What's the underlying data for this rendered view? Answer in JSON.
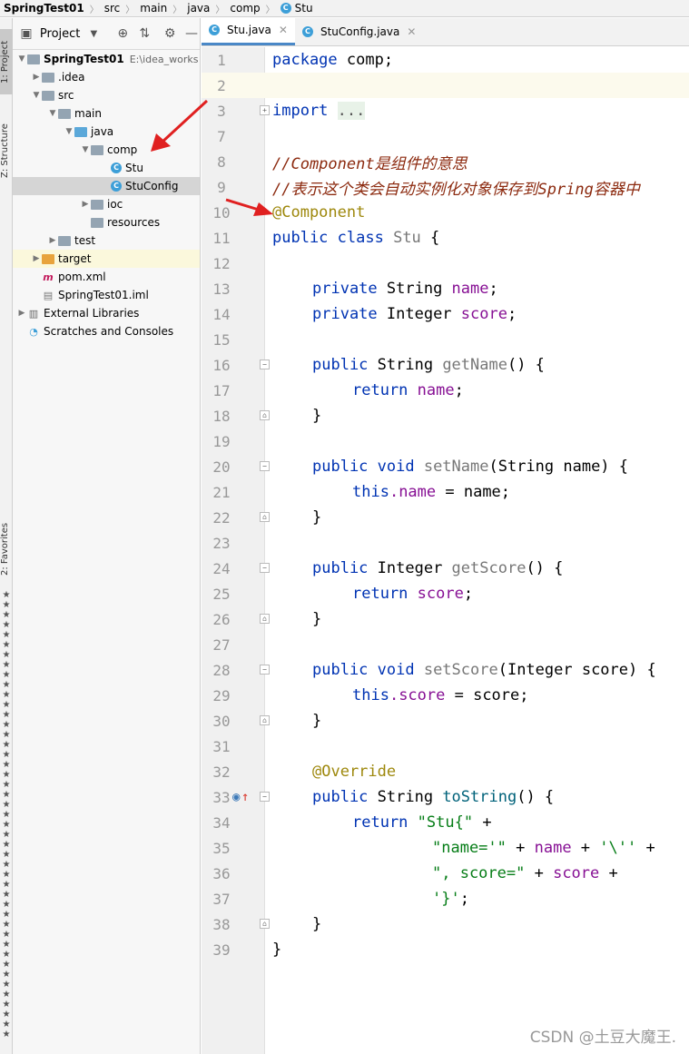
{
  "breadcrumb": [
    "SpringTest01",
    "src",
    "main",
    "java",
    "comp",
    "Stu"
  ],
  "sidebar_tabs": {
    "project": "1: Project",
    "structure": "Z: Structure",
    "favorites": "2: Favorites"
  },
  "project_panel": {
    "title": "Project",
    "tree": [
      {
        "label": "SpringTest01",
        "path": "E:\\idea_works",
        "type": "module",
        "bold": true
      },
      {
        "label": ".idea",
        "type": "folder"
      },
      {
        "label": "src",
        "type": "folder"
      },
      {
        "label": "main",
        "type": "folder"
      },
      {
        "label": "java",
        "type": "folder-blue"
      },
      {
        "label": "comp",
        "type": "package"
      },
      {
        "label": "Stu",
        "type": "class"
      },
      {
        "label": "StuConfig",
        "type": "class"
      },
      {
        "label": "ioc",
        "type": "package"
      },
      {
        "label": "resources",
        "type": "resources"
      },
      {
        "label": "test",
        "type": "folder"
      },
      {
        "label": "target",
        "type": "folder-orange"
      },
      {
        "label": "pom.xml",
        "type": "maven"
      },
      {
        "label": "SpringTest01.iml",
        "type": "iml"
      },
      {
        "label": "External Libraries",
        "type": "libs"
      },
      {
        "label": "Scratches and Consoles",
        "type": "scratch"
      }
    ]
  },
  "tabs": [
    {
      "label": "Stu.java",
      "active": true
    },
    {
      "label": "StuConfig.java",
      "active": false
    }
  ],
  "code_lines": [
    {
      "n": "1"
    },
    {
      "n": "2"
    },
    {
      "n": "3"
    },
    {
      "n": "7"
    },
    {
      "n": "8"
    },
    {
      "n": "9"
    },
    {
      "n": "10"
    },
    {
      "n": "11"
    },
    {
      "n": "12"
    },
    {
      "n": "13"
    },
    {
      "n": "14"
    },
    {
      "n": "15"
    },
    {
      "n": "16"
    },
    {
      "n": "17"
    },
    {
      "n": "18"
    },
    {
      "n": "19"
    },
    {
      "n": "20"
    },
    {
      "n": "21"
    },
    {
      "n": "22"
    },
    {
      "n": "23"
    },
    {
      "n": "24"
    },
    {
      "n": "25"
    },
    {
      "n": "26"
    },
    {
      "n": "27"
    },
    {
      "n": "28"
    },
    {
      "n": "29"
    },
    {
      "n": "30"
    },
    {
      "n": "31"
    },
    {
      "n": "32"
    },
    {
      "n": "33"
    },
    {
      "n": "34"
    },
    {
      "n": "35"
    },
    {
      "n": "36"
    },
    {
      "n": "37"
    },
    {
      "n": "38"
    },
    {
      "n": "39"
    }
  ],
  "code": {
    "l1_kw": "package",
    "l1_rest": " comp;",
    "l3_kw": "import",
    "l3_fold": "...",
    "l8": "//Component是组件的意思",
    "l9": "//表示这个类会自动实例化对象保存到Spring容器中",
    "l10": "@Component",
    "l11_kw": "public class",
    "l11_name": "Stu",
    "l11_rest": " {",
    "l13_kw": "private",
    "l13_type": " String ",
    "l13_fld": "name",
    "l13_end": ";",
    "l14_kw": "private",
    "l14_type": " Integer ",
    "l14_fld": "score",
    "l14_end": ";",
    "l16_kw": "public",
    "l16_type": " String ",
    "l16_m": "getName",
    "l16_end": "() {",
    "l17_kw": "return",
    "l17_fld": " name",
    "l17_end": ";",
    "close": "}",
    "l20_kw": "public void",
    "l20_m": " setName",
    "l20_end": "(String name) {",
    "l21_kw": "this",
    "l21_fld": ".name",
    "l21_end": " = name;",
    "l24_kw": "public",
    "l24_type": " Integer ",
    "l24_m": "getScore",
    "l24_end": "() {",
    "l25_kw": "return",
    "l25_fld": " score",
    "l25_end": ";",
    "l28_kw": "public void",
    "l28_m": " setScore",
    "l28_end": "(Integer score) {",
    "l29_kw": "this",
    "l29_fld": ".score",
    "l29_end": " = score;",
    "l32": "@Override",
    "l33_kw": "public",
    "l33_type": " String ",
    "l33_m": "toString",
    "l33_end": "() {",
    "l34_kw": "return",
    "l34_str": " \"Stu{\"",
    "l34_end": " +",
    "l35_str": "\"name='\"",
    "l35_mid": " + ",
    "l35_fld": "name",
    "l35_mid2": " + ",
    "l35_str2": "'\\''",
    "l35_end": " +",
    "l36_str": "\", score=\"",
    "l36_mid": " + ",
    "l36_fld": "score",
    "l36_end": " +",
    "l37_str": "'}'",
    "l37_end": ";"
  },
  "watermark": "CSDN @土豆大魔王."
}
